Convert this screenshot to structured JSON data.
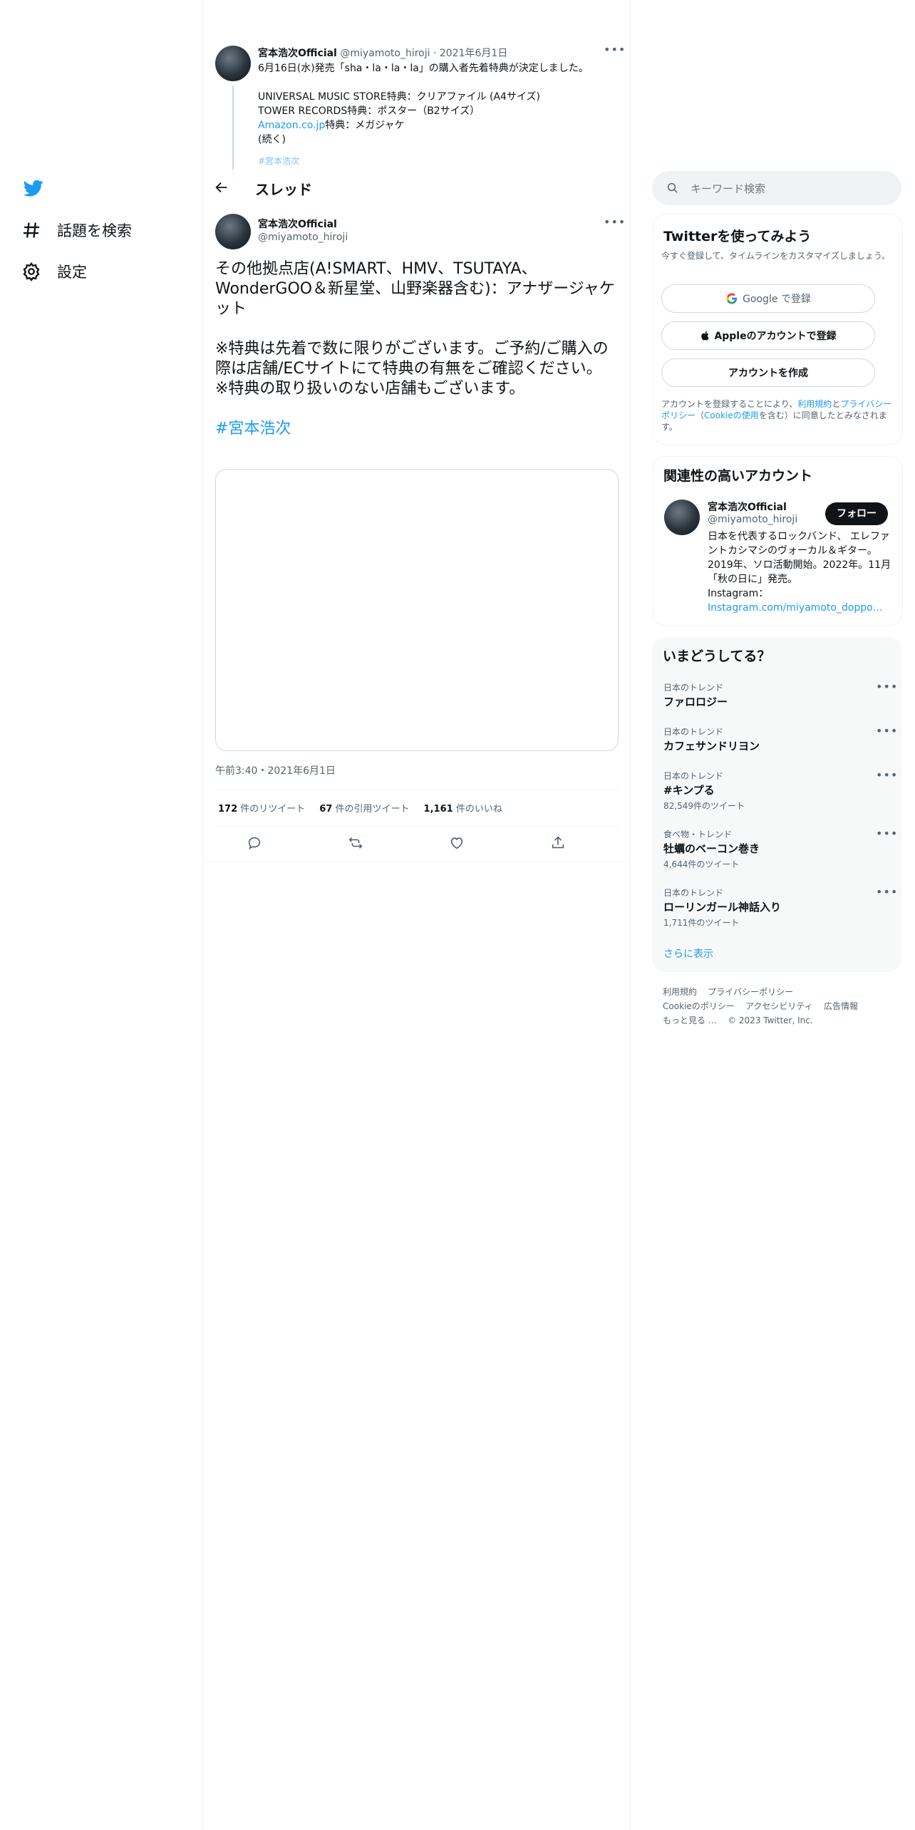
{
  "nav": {
    "items": [
      {
        "label": "話題を検索",
        "icon": "hashtag-icon"
      },
      {
        "label": "設定",
        "icon": "gear-icon"
      }
    ]
  },
  "header": {
    "title": "スレッド"
  },
  "parent_tweet": {
    "name": "宮本浩次Official",
    "handle": "@miyamoto_hiroji",
    "sep": "·",
    "date": "2021年6月1日",
    "line1": "6月16日(水)発売「sha・la・la・la」の購入者先着特典が決定しました。",
    "line2": "UNIVERSAL MUSIC STORE特典：クリアファイル (A4サイズ)",
    "line3": "TOWER RECORDS特典：ポスター（B2サイズ）",
    "line4_link": "Amazon.co.jp",
    "line4_rest": "特典：メガジャケ",
    "line5": "(続く)",
    "hashtag": "#宮本浩次"
  },
  "tweet": {
    "name": "宮本浩次Official",
    "handle": "@miyamoto_hiroji",
    "p1": "その他拠点店(A!SMART、HMV、TSUTAYA、WonderGOO＆新星堂、山野楽器含む)：アナザージャケット",
    "p2": "※特典は先着で数に限りがございます。ご予約/ご購入の際は店舗/ECサイトにて特典の有無をご確認ください。",
    "p3": "※特典の取り扱いのない店舗もございます。",
    "hashtag": "#宮本浩次",
    "timestamp": "午前3:40・2021年6月1日",
    "stats": {
      "retweets": "172",
      "retweets_label": "件のリツイート",
      "quotes": "67",
      "quotes_label": "件の引用ツイート",
      "likes": "1,161",
      "likes_label": "件のいいね"
    }
  },
  "search": {
    "placeholder": "キーワード検索"
  },
  "signup": {
    "title": "Twitterを使ってみよう",
    "subtitle": "今すぐ登録して、タイムラインをカスタマイズしましょう。",
    "google_btn": "Google で登録",
    "apple_btn": "Appleのアカウントで登録",
    "create_btn": "アカウントを作成",
    "legal_1": "アカウントを登録することにより、",
    "legal_terms": "利用規約",
    "legal_2": "と",
    "legal_privacy": "プライバシーポリシー",
    "legal_3": "（",
    "legal_cookie": "Cookieの使用",
    "legal_4": "を含む）に同意したとみなされます。"
  },
  "related": {
    "title": "関連性の高いアカウント",
    "name": "宮本浩次Official",
    "handle": "@miyamoto_hiroji",
    "follow": "フォロー",
    "bio": "日本を代表するロックバンド、 エレファントカシマシのヴォーカル＆ギター。 2019年、ソロ活動開始。2022年。11月「秋の日に」発売。",
    "bio_ig_label": "Instagram：",
    "bio_ig_link": "Instagram.com/miyamoto_doppo…"
  },
  "trends": {
    "title": "いまどうしてる？",
    "items": [
      {
        "category": "日本のトレンド",
        "name": "ファロロジー",
        "count": ""
      },
      {
        "category": "日本のトレンド",
        "name": "カフェサンドリヨン",
        "count": ""
      },
      {
        "category": "日本のトレンド",
        "name": "#キンプる",
        "count": "82,549件のツイート"
      },
      {
        "category": "食べ物・トレンド",
        "name": "牡蠣のベーコン巻き",
        "count": "4,644件のツイート"
      },
      {
        "category": "日本のトレンド",
        "name": "ローリンガール神話入り",
        "count": "1,711件のツイート"
      }
    ],
    "more": "さらに表示"
  },
  "footer": {
    "terms": "利用規約",
    "privacy": "プライバシーポリシー",
    "cookie": "Cookieのポリシー",
    "accessibility": "アクセシビリティ",
    "ads": "広告情報",
    "more": "もっと見る …",
    "copyright": "© 2023 Twitter, Inc."
  },
  "colors": {
    "accent": "#1d9bf0",
    "text": "#0f1419",
    "muted": "#536471",
    "border": "#eff3f4"
  }
}
